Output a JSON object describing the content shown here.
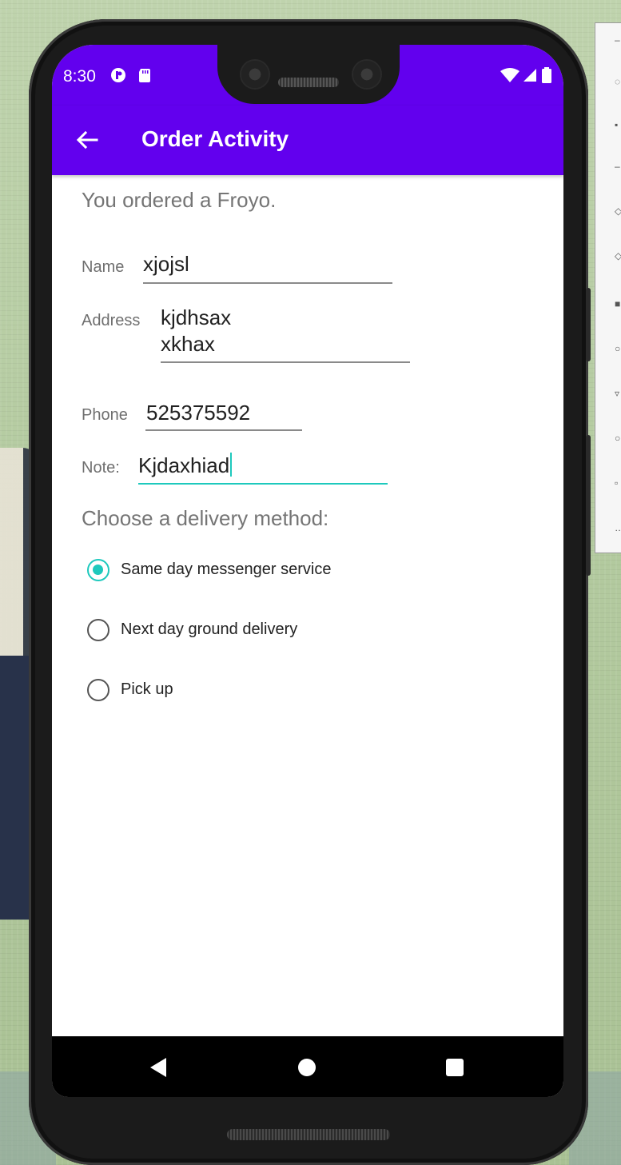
{
  "status_bar": {
    "time": "8:30",
    "icons": [
      "notification-icon",
      "sd-card-icon",
      "wifi-icon",
      "signal-icon",
      "battery-icon"
    ]
  },
  "app_bar": {
    "title": "Order Activity",
    "back_icon": "arrow-back-icon",
    "color": "#6200ee"
  },
  "content": {
    "order_message": "You ordered a Froyo.",
    "fields": {
      "name": {
        "label": "Name",
        "value": "xjojsl"
      },
      "address": {
        "label": "Address",
        "line1": "kjdhsax",
        "line2": "xkhax"
      },
      "phone": {
        "label": "Phone",
        "value": "525375592"
      },
      "note": {
        "label": "Note:",
        "value": "Kjdaxhiad",
        "focused": true
      }
    },
    "delivery": {
      "title": "Choose a delivery method:",
      "options": [
        {
          "label": "Same day messenger service",
          "selected": true
        },
        {
          "label": "Next day ground delivery",
          "selected": false
        },
        {
          "label": "Pick up",
          "selected": false
        }
      ]
    }
  },
  "nav_bar": {
    "icons": [
      "nav-back-icon",
      "nav-home-icon",
      "nav-recents-icon"
    ]
  },
  "emulator_toolbar": {
    "icons": [
      "minimize-icon",
      "power-icon",
      "volume-up-icon",
      "volume-down-icon",
      "rotate-left-icon",
      "rotate-right-icon",
      "camera-icon",
      "zoom-icon",
      "back-icon",
      "home-icon",
      "overview-icon",
      "more-icon"
    ]
  },
  "colors": {
    "accent": "#1ec9bd",
    "primary": "#6200ee"
  }
}
